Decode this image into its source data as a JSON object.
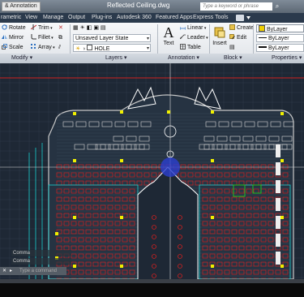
{
  "titlebar": {
    "workspace": "& Annotation",
    "document_title": "Reflected Ceiling.dwg",
    "search_placeholder": "Type a keyword or phrase"
  },
  "menubar": {
    "items": [
      "rametric",
      "View",
      "Manage",
      "Output",
      "Plug-ins",
      "Autodesk 360",
      "Featured Apps",
      "Express Tools"
    ]
  },
  "ribbon": {
    "modify": {
      "title": "Modify",
      "buttons": [
        "Rotate",
        "Trim",
        "Mirror",
        "Fillet",
        "Scale",
        "Array"
      ]
    },
    "layers": {
      "title": "Layers",
      "layer_state": "Unsaved Layer State",
      "current_layer": "HOLE"
    },
    "annotation": {
      "title": "Annotation",
      "text_label": "Text",
      "linear_label": "Linear",
      "leader_label": "Leader",
      "table_label": "Table"
    },
    "block": {
      "title": "Block",
      "insert_label": "Insert",
      "create_label": "Create",
      "edit_label": "Edit"
    },
    "properties": {
      "title": "Properties",
      "color": "ByLayer",
      "linetype": "ByLayer",
      "lineweight": "ByLayer"
    }
  },
  "command": {
    "history_1": "Comma",
    "history_2": "Comma",
    "prompt": "Type a command"
  },
  "colors": {
    "canvas_bg": "#1e2835",
    "grid": "#2f3b4a",
    "walls": "#c8c8c8",
    "red": "#d02020",
    "cyan": "#18d0d0",
    "yellow": "#f0f000",
    "green": "#20c020",
    "menubar_bg": "#2b3a4c"
  }
}
